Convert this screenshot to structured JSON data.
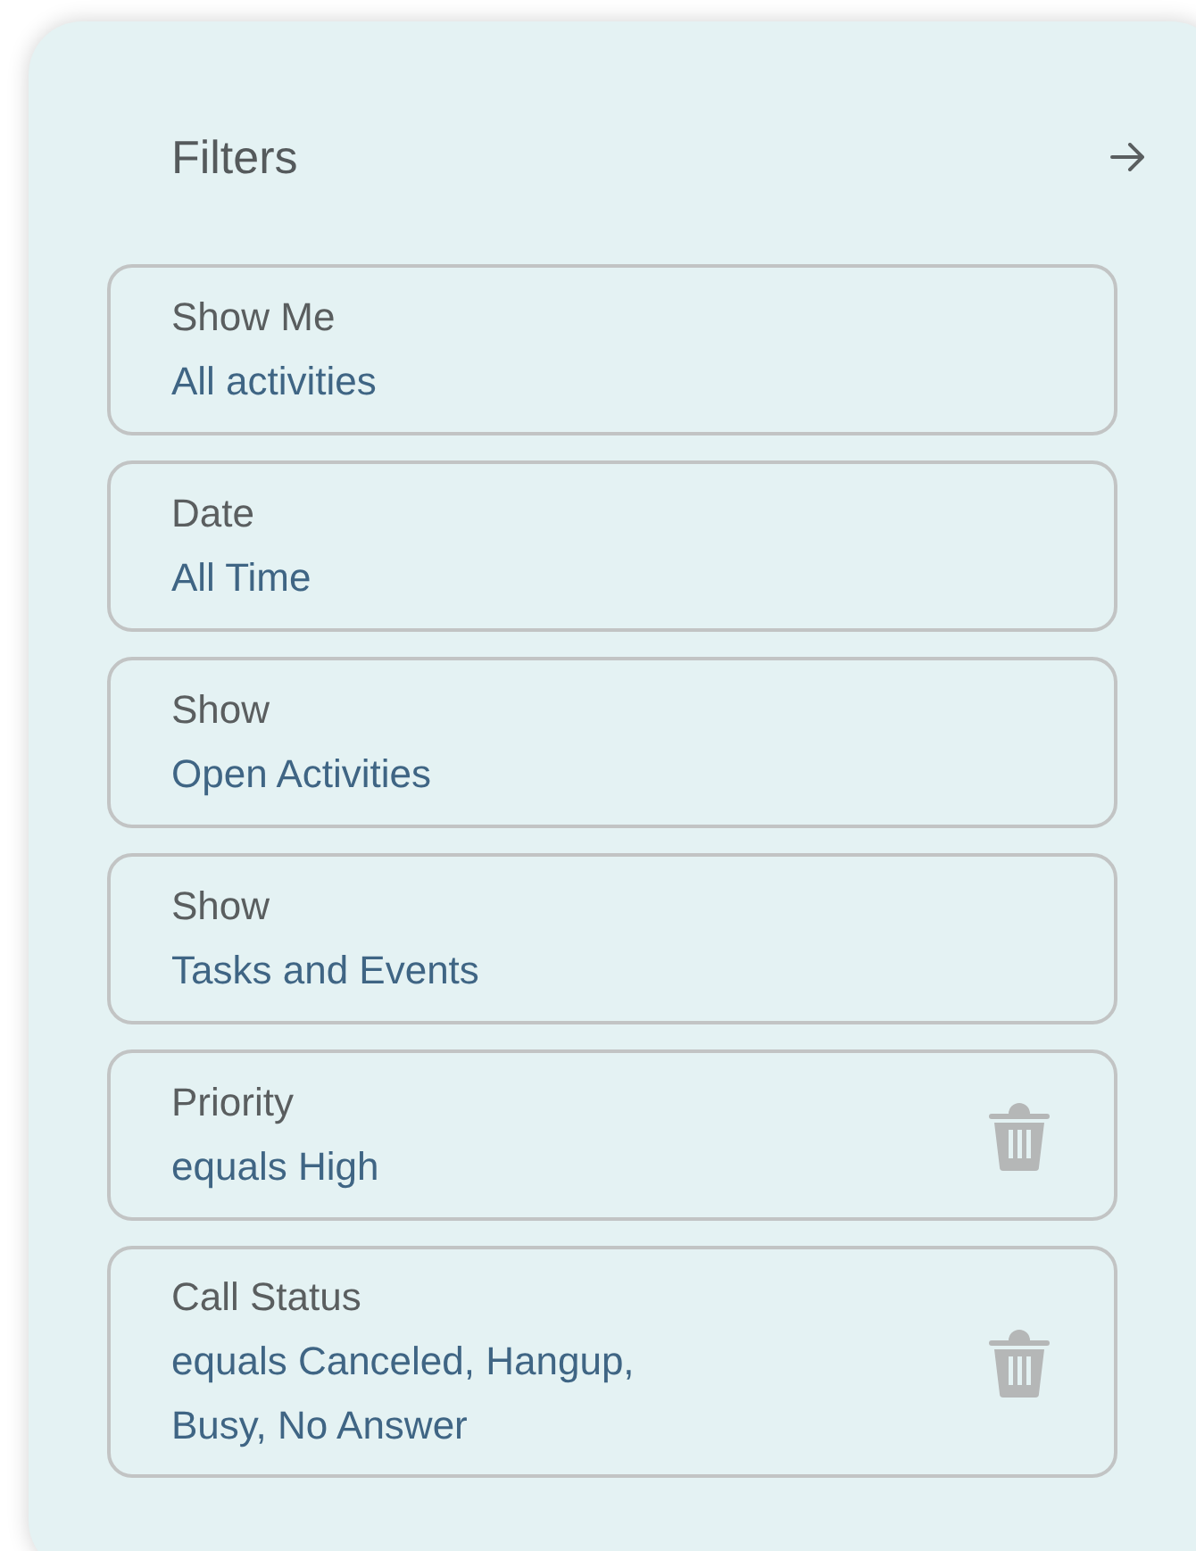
{
  "panel": {
    "title": "Filters"
  },
  "filters": [
    {
      "label": "Show Me",
      "value": "All activities",
      "removable": false
    },
    {
      "label": "Date",
      "value": "All Time",
      "removable": false
    },
    {
      "label": "Show",
      "value": "Open Activities",
      "removable": false
    },
    {
      "label": "Show",
      "value": "Tasks and Events",
      "removable": false
    },
    {
      "label": "Priority",
      "value": "equals High",
      "removable": true
    },
    {
      "label": "Call Status",
      "value": "equals Canceled, Hangup, Busy, No Answer",
      "removable": true
    }
  ]
}
